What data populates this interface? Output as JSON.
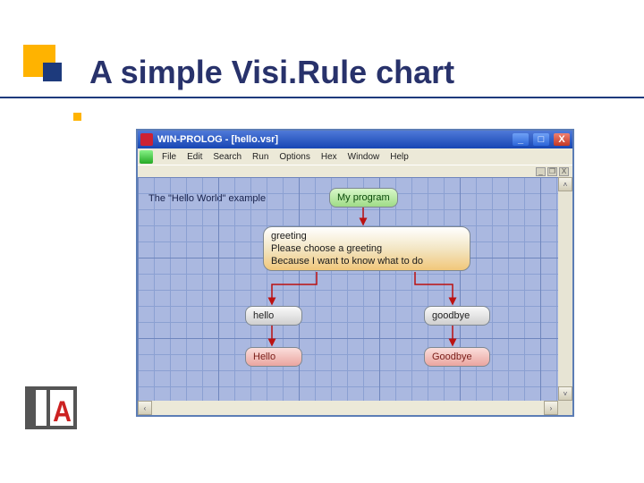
{
  "slide": {
    "title": "A simple Visi.Rule chart"
  },
  "window": {
    "title": "WIN-PROLOG - [hello.vsr]",
    "buttons": {
      "min": "_",
      "max": "□",
      "close": "X"
    },
    "menu": [
      "File",
      "Edit",
      "Search",
      "Run",
      "Options",
      "Hex",
      "Window",
      "Help"
    ],
    "sub": {
      "min": "_",
      "restore": "❐",
      "close": "X"
    }
  },
  "diagram": {
    "comment": "The \"Hello World\" example",
    "start": "My program",
    "step": {
      "name": "greeting",
      "prompt": "Please choose a greeting",
      "reason": "Because I want to know what to do"
    },
    "branches": {
      "left": "hello",
      "right": "goodbye"
    },
    "ends": {
      "left": "Hello",
      "right": "Goodbye"
    }
  },
  "scroll": {
    "left": "‹",
    "right": "›",
    "up": "˄",
    "down": "˅"
  }
}
